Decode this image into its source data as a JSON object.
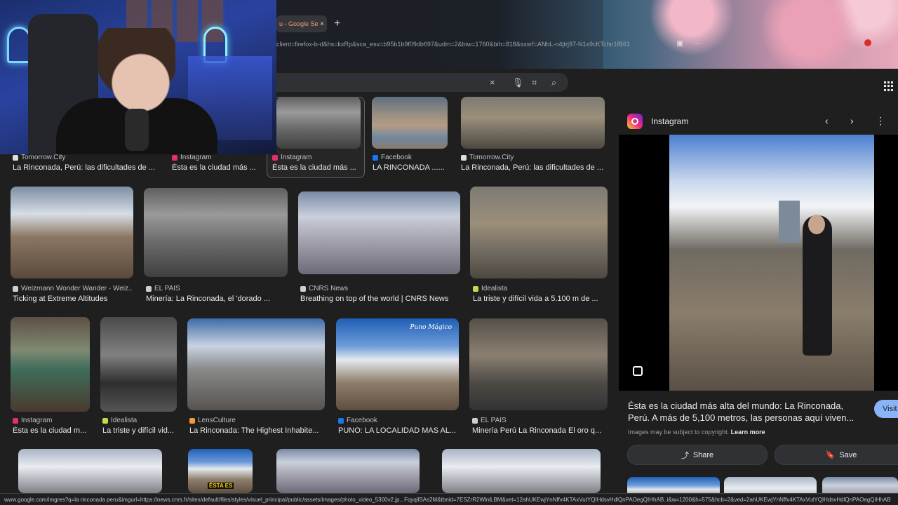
{
  "browser": {
    "tab_title": "u - Google Sea",
    "tab_close": "×",
    "new_tab": "+",
    "url": "client=firefox-b-d&hs=kxRp&sca_esv=b95b1b9f09db697&udm=2&biw=1760&bih=818&sxsrf=ANbL-n4jtrj97-N1s9cKTchn1fB61"
  },
  "search": {
    "clear_icon": "×",
    "mic_icon": "🎙",
    "lens_icon": "⌗",
    "search_icon": "⌕"
  },
  "top_row": [
    {
      "source": "Tomorrow.City",
      "caption": "La Rinconada, Perú: las dificultades de ...",
      "fav": "#dddddd"
    },
    {
      "source": "Instagram",
      "caption": "Ésta es la ciudad más ...",
      "fav": "#e1306c"
    },
    {
      "source": "Instagram",
      "caption": "Ésta es la ciudad más ...",
      "fav": "#e1306c"
    },
    {
      "source": "Facebook",
      "caption": "LA RINCONADA ......",
      "fav": "#1877f2"
    },
    {
      "source": "Tomorrow.City",
      "caption": "La Rinconada, Perú: las dificultades de ...",
      "fav": "#dddddd"
    }
  ],
  "row2": [
    {
      "source": "Weizmann Wonder Wander - Weiz...",
      "caption": "Ticking at Extreme Altitudes",
      "fav": "#cfcfcf"
    },
    {
      "source": "EL PAÍS",
      "caption": "Minería: La Rinconada, el 'dorado ...",
      "fav": "#cfcfcf"
    },
    {
      "source": "CNRS News",
      "caption": "Breathing on top of the world | CNRS News",
      "fav": "#cfcfcf"
    },
    {
      "source": "Idealista",
      "caption": "La triste y difícil vida a 5.100 m de ...",
      "fav": "#c7d94a"
    }
  ],
  "row3": [
    {
      "source": "Instagram",
      "caption": "Ésta es la ciudad m...",
      "fav": "#e1306c"
    },
    {
      "source": "Idealista",
      "caption": "La triste y difícil vid...",
      "fav": "#c7d94a"
    },
    {
      "source": "LensCulture",
      "caption": "La Rinconada: The Highest Inhabite...",
      "fav": "#f29b3a"
    },
    {
      "source": "Facebook",
      "caption": "PUNO: LA LOCALIDAD MAS AL...",
      "fav": "#1877f2"
    },
    {
      "source": "EL PAÍS",
      "caption": "Minería Perú La Rinconada El oro q...",
      "fav": "#cfcfcf"
    }
  ],
  "thumb_overlays": {
    "puno": "Puno Mágico",
    "esta": "ÉSTA ES"
  },
  "panel": {
    "source": "Instagram",
    "prev_icon": "‹",
    "next_icon": "›",
    "more_icon": "⋮",
    "title": "Ésta es la ciudad más alta del mundo: La Rinconada, Perú. A más de 5,100 metros, las personas aquí viven...",
    "visit_label": "Visit",
    "copyright": "Images may be subject to copyright.",
    "learn_more": "Learn more",
    "share_label": "Share",
    "save_label": "Save",
    "share_icon": "⤴",
    "save_icon": "🔖"
  },
  "status_url": "www.google.com/imgres?q=la rinconada peru&imgurl=https://news.cnrs.fr/sites/default/files/styles/visuel_principal/public/assets/images/photo_video_5300v2.jp...FqyqilSAs2M&tbnid=7ESZrR2WlnlLBM&vet=12ahUKEwjYnNffv4KTAxVutYQIHdsvHdlQnPAOegQIHhAB..i&w=1200&h=575&hcb=2&ved=2ahUKEwjYnNffv4KTAxVutYQIHdsvHdlQnPAOegQIHhAB"
}
